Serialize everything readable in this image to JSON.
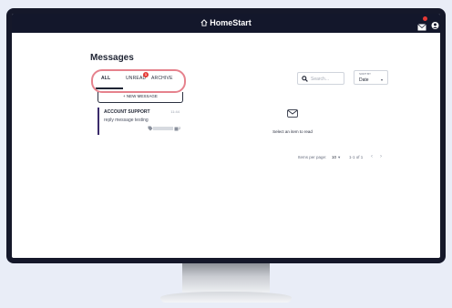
{
  "header": {
    "brand": "HomeStart",
    "mail_badge_count": "",
    "icons": [
      "home-icon",
      "mail-icon",
      "user-icon"
    ]
  },
  "messages": {
    "title": "Messages",
    "tabs": [
      {
        "label": "ALL",
        "active": true
      },
      {
        "label": "UNREAD",
        "badge": "1"
      },
      {
        "label": "ARCHIVE"
      }
    ],
    "new_message_label": "+ NEW MESSAGE",
    "list": [
      {
        "from": "ACCOUNT SUPPORT",
        "time": "11:44",
        "preview": "reply message testing",
        "tag_count": "2"
      }
    ]
  },
  "toolbar": {
    "search_placeholder": "Search...",
    "sort_label": "SORT BY",
    "sort_value": "Date"
  },
  "empty_state": {
    "text": "Select an item to read"
  },
  "pagination": {
    "items_per_page_label": "Items per page:",
    "items_per_page_value": "10",
    "range": "1-1 of 1"
  },
  "colors": {
    "topbar": "#13172b",
    "badge": "#e53935",
    "highlight": "#e6828d",
    "accent": "#3b2b6b"
  }
}
